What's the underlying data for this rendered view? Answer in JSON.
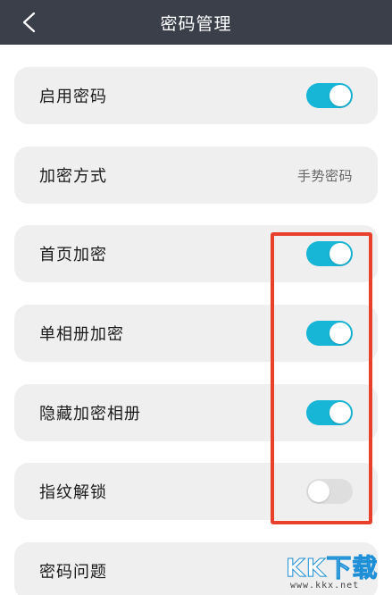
{
  "header": {
    "title": "密码管理",
    "back_icon": "chevron-left-icon"
  },
  "settings": [
    {
      "label": "启用密码",
      "control": "toggle",
      "on": true
    },
    {
      "label": "加密方式",
      "control": "value",
      "value": "手势密码"
    },
    {
      "label": "首页加密",
      "control": "toggle",
      "on": true
    },
    {
      "label": "单相册加密",
      "control": "toggle",
      "on": true
    },
    {
      "label": "隐藏加密相册",
      "control": "toggle",
      "on": true
    },
    {
      "label": "指纹解锁",
      "control": "toggle",
      "on": false
    },
    {
      "label": "密码问题",
      "control": "none"
    }
  ],
  "colors": {
    "header_bg": "#3a3f4a",
    "toggle_on": "#17b5d6",
    "toggle_off": "#dedede",
    "highlight": "#e8402b"
  },
  "watermark": {
    "text": "KK下载",
    "url": "www.kkx.net"
  }
}
